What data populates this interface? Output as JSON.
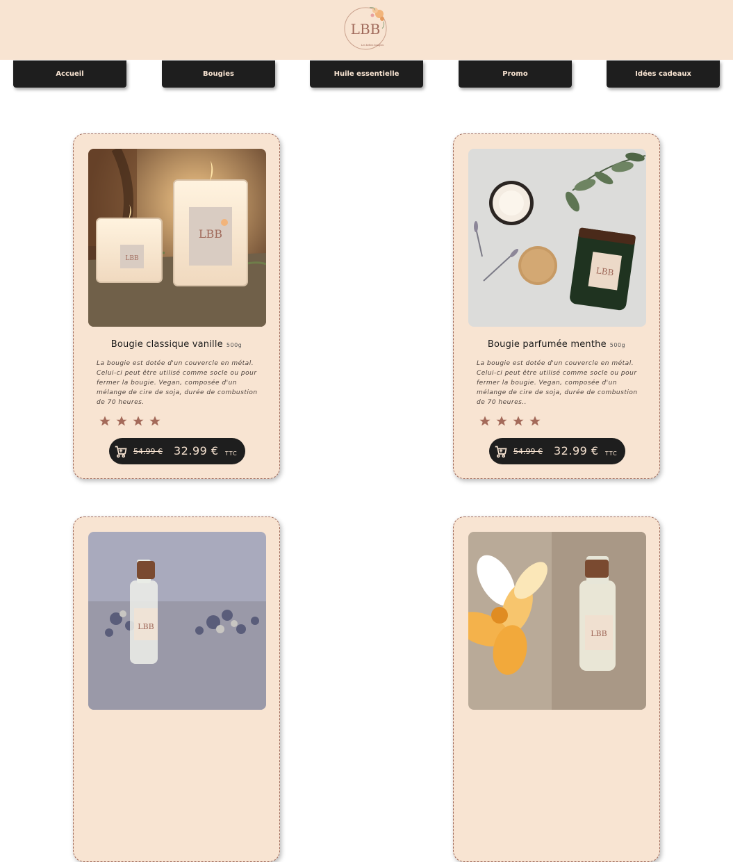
{
  "header": {
    "logo_text": "LBB",
    "logo_subtitle": "Les belles bougies"
  },
  "nav": [
    {
      "label": "Accueil"
    },
    {
      "label": "Bougies"
    },
    {
      "label": "Huile essentielle"
    },
    {
      "label": "Promo"
    },
    {
      "label": "Idées cadeaux"
    }
  ],
  "products": [
    {
      "title": "Bougie classique vanille",
      "weight": "500g",
      "description": "La bougie est dotée d'un couvercle en métal. Celui-ci peut être utilisé comme socle ou pour fermer la bougie. Vegan, composée d'un mélange de cire de soja, durée de combustion de 70 heures.",
      "rating": 4,
      "old_price": "54.99 €",
      "price": "32.99 €",
      "tax": "TTC"
    },
    {
      "title": "Bougie parfumée menthe",
      "weight": "500g",
      "description": "La bougie est dotée d'un couvercle en métal. Celui-ci peut être utilisé comme socle ou pour fermer la bougie. Vegan, composée d'un mélange de cire de soja, durée de combustion de 70 heures..",
      "rating": 4,
      "old_price": "54.99 €",
      "price": "32.99 €",
      "tax": "TTC"
    }
  ],
  "colors": {
    "header_bg": "#f8e4d2",
    "dark": "#1e1e1e",
    "star": "#a46a5a",
    "accent_text": "#f8e4d2"
  },
  "icons": {
    "cart": "shopping-cart-icon",
    "star": "star-icon"
  }
}
